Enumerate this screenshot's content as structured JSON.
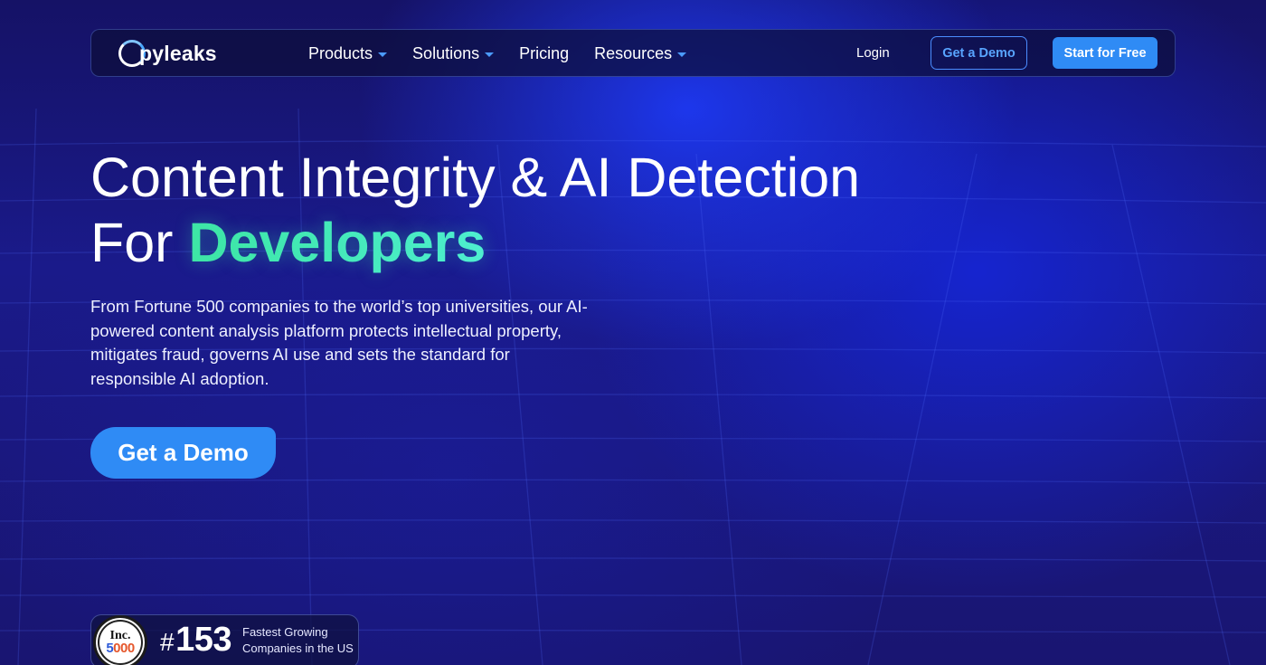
{
  "brand": {
    "name": "Copyleaks",
    "name_rest": "pyleaks",
    "name_initial": "Co"
  },
  "nav": {
    "items": [
      {
        "label": "Products",
        "has_dropdown": true
      },
      {
        "label": "Solutions",
        "has_dropdown": true
      },
      {
        "label": "Pricing",
        "has_dropdown": false
      },
      {
        "label": "Resources",
        "has_dropdown": true
      }
    ],
    "login_label": "Login",
    "demo_label": "Get a Demo",
    "start_label": "Start for Free"
  },
  "hero": {
    "title_line1": "Content Integrity & AI Detection",
    "title_line2_prefix": "For ",
    "title_line2_accent": "Developers",
    "description": "From Fortune 500 companies to the world’s top universities, our AI-powered content analysis platform protects intellectual property, mitigates fraud, governs AI use and sets the standard for responsible AI adoption.",
    "cta_label": "Get a Demo"
  },
  "badge": {
    "seal_top": "Inc.",
    "seal_num_a": "5",
    "seal_num_b": "000",
    "rank_hash": "#",
    "rank_number": "153",
    "label_line1": "Fastest Growing",
    "label_line2": "Companies in the US"
  },
  "colors": {
    "background": "#14115a",
    "accent_blue": "#2f8bf5",
    "accent_green": "#3ee6a5",
    "caret": "#4b9bff"
  },
  "icons": [
    "logo-ring-icon",
    "chevron-down-icon",
    "inc-5000-seal-icon"
  ]
}
